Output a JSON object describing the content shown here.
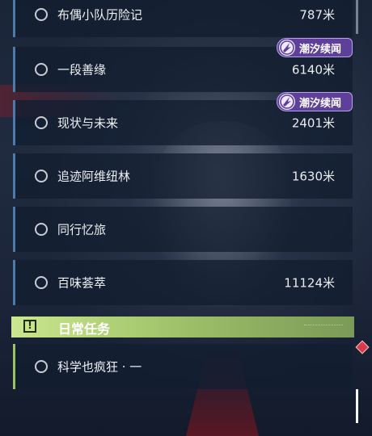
{
  "quests": [
    {
      "title": "布偶小队历险记",
      "distance": "787米",
      "badge": ""
    },
    {
      "title": "一段善缘",
      "distance": "6140米",
      "badge": "潮汐续闻"
    },
    {
      "title": "现状与未来",
      "distance": "2401米",
      "badge": "潮汐续闻"
    },
    {
      "title": "追迹阿维纽林",
      "distance": "1630米",
      "badge": ""
    },
    {
      "title": "同行忆旅",
      "distance": "",
      "badge": ""
    },
    {
      "title": "百味荟萃",
      "distance": "11124米",
      "badge": ""
    }
  ],
  "daily": {
    "header": "日常任务",
    "icon": "exclamation-icon",
    "quests": [
      {
        "title": "科学也疯狂 · 一",
        "distance": ""
      }
    ]
  },
  "colors": {
    "blue_accent": "#4f7aa8",
    "green_accent": "#a6c86e",
    "badge_purple": "#5e3f9a",
    "new_marker_red": "#d8394b"
  }
}
